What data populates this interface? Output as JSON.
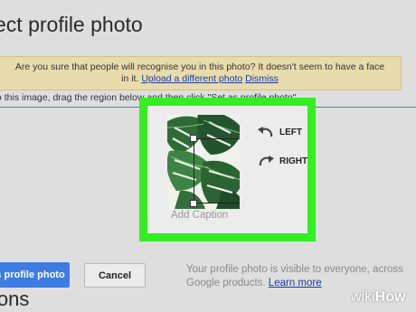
{
  "dialog": {
    "title": "ect profile photo",
    "warning": {
      "text_line1": "Are you sure that people will recognise you in this photo? It doesn't seem to have a face",
      "text_line2_prefix": "in it.",
      "upload_link": "Upload a different photo",
      "dismiss_link": "Dismiss"
    },
    "instruction": "o this image, drag the region below and then click \"Set as profile photo\"",
    "editor": {
      "rotate_left_label": "LEFT",
      "rotate_right_label": "RIGHT",
      "caption_placeholder": "Add Caption"
    },
    "actions": {
      "set_profile_label": "s profile photo",
      "cancel_label": "Cancel"
    },
    "note": {
      "text": "Your profile photo is visible to everyone, across Google products.",
      "learn_more": "Learn more"
    },
    "bottom_text": "ions"
  },
  "watermark": {
    "prefix": "wiki",
    "suffix": "How"
  },
  "colors": {
    "highlight": "#33ee22",
    "primary_button": "#3d7ce0",
    "link": "#1a3aa0",
    "warning_bg": "#e8dbac"
  }
}
